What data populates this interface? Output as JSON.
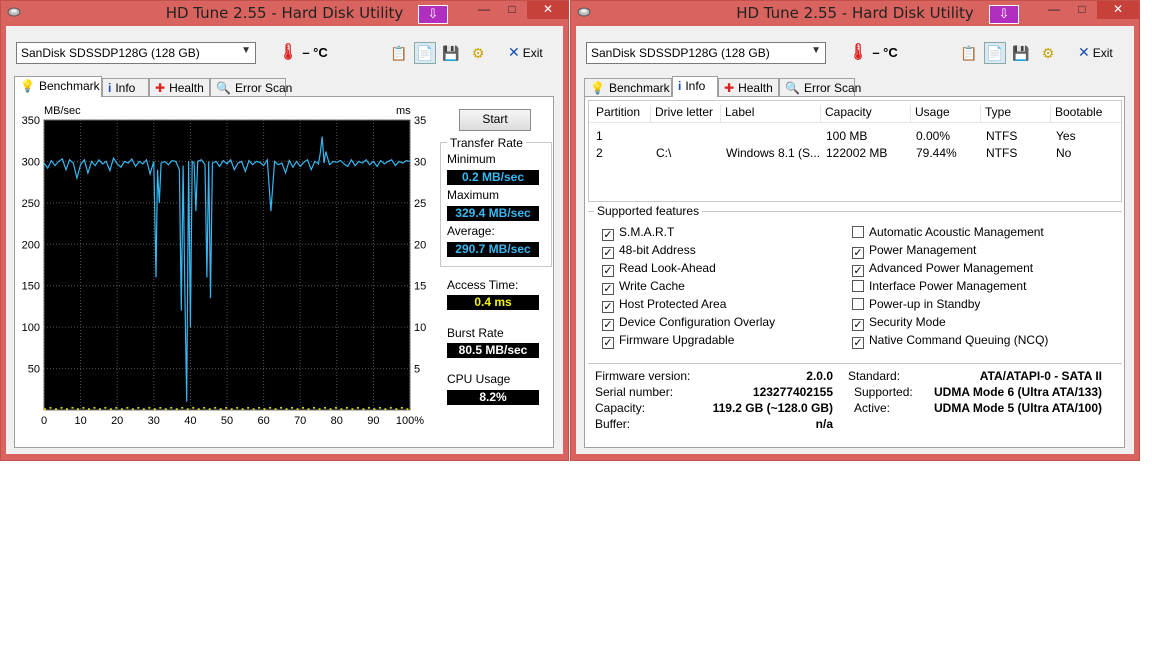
{
  "colors": {
    "window_frame": "#d9645f",
    "close_button": "#c7403a",
    "title_badge": "#b12fbf",
    "chart_background": "#000000",
    "transfer_line": "#38b8f2",
    "access_points": "#f2f20a",
    "grid": "#555555"
  },
  "window_left": {
    "title": "HD Tune 2.55 - Hard Disk Utility",
    "badge": "⇩",
    "controls": {
      "minimize": "—",
      "maximize": "□",
      "close": "✕"
    },
    "toolbar": {
      "drive": "SanDisk SDSSDP128G (128 GB)",
      "temperature": "– °C",
      "exit_label": "Exit",
      "icons": [
        "copy-text-icon",
        "copy-screenshot-icon",
        "save-icon",
        "options-icon"
      ]
    },
    "tabs": [
      {
        "label": "Benchmark",
        "icon": "lightbulb-icon",
        "active": true
      },
      {
        "label": "Info",
        "icon": "info-icon",
        "active": false
      },
      {
        "label": "Health",
        "icon": "health-cross-icon",
        "active": false
      },
      {
        "label": "Error Scan",
        "icon": "magnifier-icon",
        "active": false
      }
    ],
    "benchmark": {
      "start_label": "Start",
      "transfer_rate_label": "Transfer Rate",
      "minimum_label": "Minimum",
      "minimum_value": "0.2 MB/sec",
      "maximum_label": "Maximum",
      "maximum_value": "329.4 MB/sec",
      "average_label": "Average:",
      "average_value": "290.7 MB/sec",
      "access_time_label": "Access Time:",
      "access_time_value": "0.4 ms",
      "burst_rate_label": "Burst Rate",
      "burst_rate_value": "80.5 MB/sec",
      "cpu_usage_label": "CPU Usage",
      "cpu_usage_value": "8.2%"
    }
  },
  "chart_data": {
    "type": "line",
    "y_left_label": "MB/sec",
    "y_right_label": "ms",
    "y_left_ticks": [
      "350",
      "300",
      "250",
      "200",
      "150",
      "100",
      "50"
    ],
    "y_right_ticks": [
      "35",
      "30",
      "25",
      "20",
      "15",
      "10",
      "5"
    ],
    "x_ticks": [
      "0",
      "10",
      "20",
      "30",
      "40",
      "50",
      "60",
      "70",
      "80",
      "90",
      "100%"
    ],
    "ylim_left": [
      0,
      350
    ],
    "ylim_right": [
      0,
      35
    ],
    "xlim": [
      0,
      100
    ],
    "grid": true,
    "series": [
      {
        "x": [
          0,
          1,
          2,
          3,
          4,
          5,
          6,
          7,
          8,
          9,
          10,
          11,
          12,
          13,
          14,
          15,
          16,
          17,
          18,
          19,
          20,
          21,
          22,
          23,
          24,
          25,
          26,
          27,
          28,
          29,
          30,
          30.6,
          31,
          31.5,
          32,
          33,
          34,
          35,
          36,
          37,
          37.5,
          38,
          38.5,
          39,
          39.5,
          40,
          40.5,
          41,
          41.5,
          42,
          43,
          44,
          44.5,
          45,
          45.5,
          46,
          47,
          48,
          49,
          50,
          51,
          52,
          53,
          54,
          55,
          56,
          57,
          58,
          59,
          60,
          61,
          62,
          63,
          64,
          65,
          66,
          67,
          68,
          69,
          70,
          71,
          72,
          73,
          74,
          75,
          75.5,
          76,
          76.5,
          77,
          78,
          79,
          80,
          81,
          82,
          83,
          84,
          85,
          86,
          87,
          88,
          89,
          90,
          91,
          92,
          93,
          94,
          95,
          96,
          97,
          98,
          99,
          100
        ],
        "values": [
          298,
          292,
          301,
          295,
          300,
          303,
          290,
          302,
          298,
          280,
          296,
          302,
          286,
          300,
          295,
          302,
          297,
          300,
          289,
          304,
          297,
          293,
          300,
          298,
          303,
          294,
          300,
          297,
          302,
          285,
          300,
          160,
          290,
          250,
          298,
          300,
          296,
          301,
          300,
          290,
          120,
          295,
          140,
          10,
          300,
          100,
          300,
          298,
          240,
          300,
          302,
          296,
          160,
          300,
          135,
          298,
          300,
          294,
          301,
          297,
          302,
          290,
          298,
          300,
          288,
          301,
          296,
          300,
          299,
          295,
          302,
          240,
          300,
          296,
          298,
          286,
          301,
          293,
          300,
          294,
          299,
          302,
          290,
          300,
          297,
          310,
          330,
          298,
          312,
          296,
          300,
          299,
          301,
          297,
          294,
          302,
          295,
          300,
          298,
          302,
          296,
          300,
          294,
          301,
          297,
          300,
          302,
          295,
          300,
          298,
          301,
          300
        ]
      }
    ]
  },
  "window_right": {
    "title": "HD Tune 2.55 - Hard Disk Utility",
    "badge": "⇩",
    "controls": {
      "minimize": "—",
      "maximize": "□",
      "close": "✕"
    },
    "toolbar": {
      "drive": "SanDisk SDSSDP128G (128 GB)",
      "temperature": "– °C",
      "exit_label": "Exit"
    },
    "tabs": [
      {
        "label": "Benchmark",
        "icon": "lightbulb-icon",
        "active": false
      },
      {
        "label": "Info",
        "icon": "info-icon",
        "active": true
      },
      {
        "label": "Health",
        "icon": "health-cross-icon",
        "active": false
      },
      {
        "label": "Error Scan",
        "icon": "magnifier-icon",
        "active": false
      }
    ],
    "partitions": {
      "columns": [
        "Partition",
        "Drive letter",
        "Label",
        "Capacity",
        "Usage",
        "Type",
        "Bootable"
      ],
      "rows": [
        [
          "1",
          "",
          "",
          "100 MB",
          "0.00%",
          "NTFS",
          "Yes"
        ],
        [
          "2",
          "C:\\",
          "Windows 8.1 (S...",
          "122002 MB",
          "79.44%",
          "NTFS",
          "No"
        ]
      ]
    },
    "supported_features_label": "Supported features",
    "features_left": [
      {
        "label": "S.M.A.R.T",
        "checked": true
      },
      {
        "label": "48-bit Address",
        "checked": true
      },
      {
        "label": "Read Look-Ahead",
        "checked": true
      },
      {
        "label": "Write Cache",
        "checked": true
      },
      {
        "label": "Host Protected Area",
        "checked": true
      },
      {
        "label": "Device Configuration Overlay",
        "checked": true
      },
      {
        "label": "Firmware Upgradable",
        "checked": true
      }
    ],
    "features_right": [
      {
        "label": "Automatic Acoustic Management",
        "checked": false
      },
      {
        "label": "Power Management",
        "checked": true
      },
      {
        "label": "Advanced Power Management",
        "checked": true
      },
      {
        "label": "Interface Power Management",
        "checked": false
      },
      {
        "label": "Power-up in Standby",
        "checked": false
      },
      {
        "label": "Security Mode",
        "checked": true
      },
      {
        "label": "Native Command Queuing (NCQ)",
        "checked": true
      }
    ],
    "drive_info": {
      "firmware_label": "Firmware version:",
      "firmware_value": "2.0.0",
      "serial_label": "Serial number:",
      "serial_value": "123277402155",
      "capacity_label": "Capacity:",
      "capacity_value": "119.2 GB (~128.0 GB)",
      "buffer_label": "Buffer:",
      "buffer_value": "n/a",
      "standard_label": "Standard:",
      "standard_value": "ATA/ATAPI-0 - SATA II",
      "supported_label": "Supported:",
      "supported_value": "UDMA Mode 6 (Ultra ATA/133)",
      "active_label": "Active:",
      "active_value": "UDMA Mode 5 (Ultra ATA/100)"
    }
  }
}
